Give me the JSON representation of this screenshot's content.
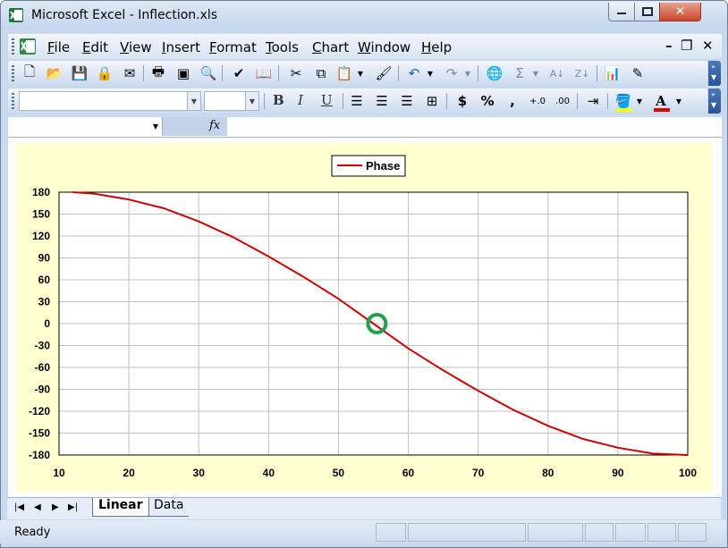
{
  "window": {
    "title": "Microsoft Excel - Inflection.xls",
    "app_icon": "excel-icon"
  },
  "menu": [
    "File",
    "Edit",
    "View",
    "Insert",
    "Format",
    "Tools",
    "Chart",
    "Window",
    "Help"
  ],
  "formula_bar": {
    "name_box": "",
    "fx_label": "fx",
    "formula": ""
  },
  "format_toolbar": {
    "font_name": "",
    "font_size": "",
    "comma": ","
  },
  "chart_data": {
    "type": "line",
    "xlim": [
      10,
      100
    ],
    "ylim": [
      -180,
      180
    ],
    "xticks": [
      10,
      20,
      30,
      40,
      50,
      60,
      70,
      80,
      90,
      100
    ],
    "yticks": [
      180,
      150,
      120,
      90,
      60,
      30,
      0,
      -30,
      -60,
      -90,
      -120,
      -150,
      -180
    ],
    "grid": true,
    "legend_placement": "top-center",
    "series": [
      {
        "name": "Phase",
        "color": "#cc0000",
        "x": [
          12,
          15,
          20,
          25,
          30,
          35,
          40,
          45,
          50,
          55,
          60,
          65,
          70,
          75,
          80,
          85,
          90,
          95,
          100
        ],
        "y": [
          180,
          178,
          170,
          158,
          140,
          118,
          92,
          64,
          34,
          0,
          -34,
          -64,
          -92,
          -118,
          -140,
          -158,
          -170,
          -178,
          -180
        ]
      }
    ],
    "annotation": {
      "type": "circle",
      "x": 55.5,
      "y": 0,
      "color": "#22a050"
    }
  },
  "sheet_tabs": {
    "active": "Linear",
    "inactive": "Data"
  },
  "status": {
    "text": "Ready"
  }
}
